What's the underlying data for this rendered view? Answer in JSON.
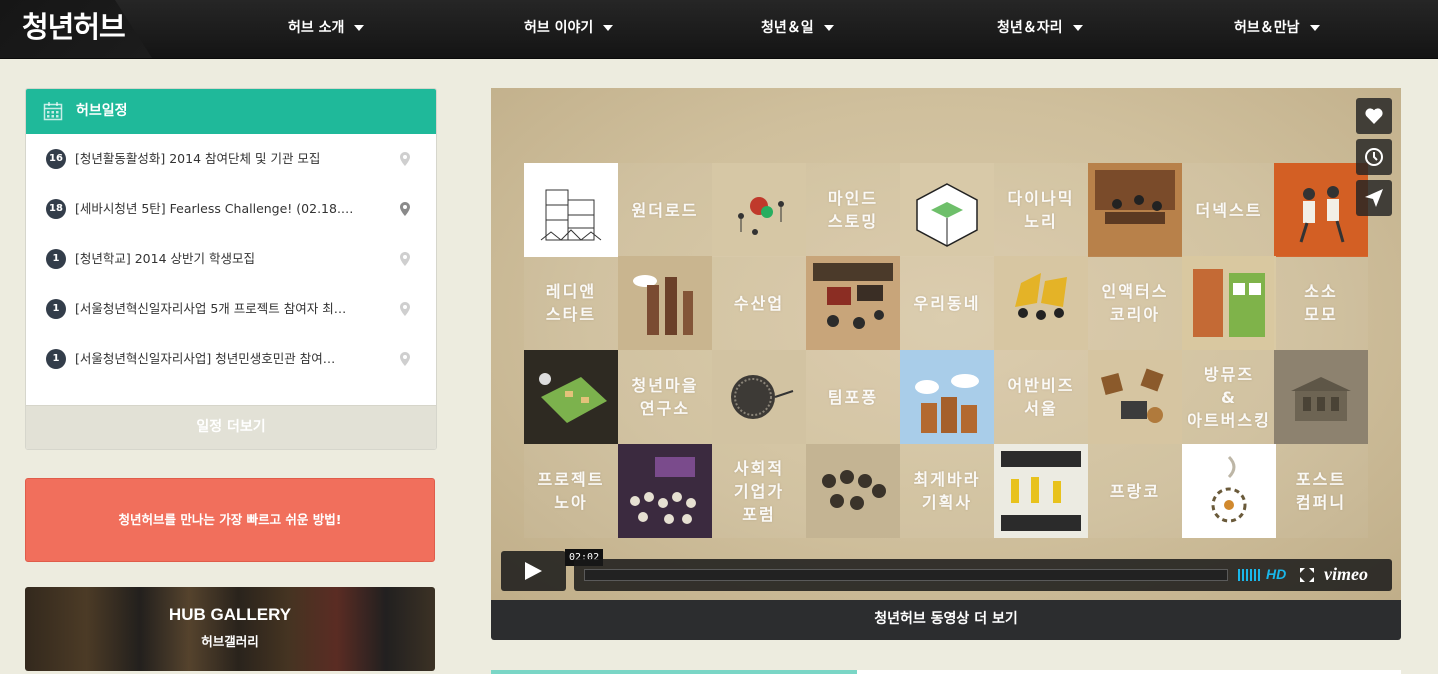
{
  "header": {
    "logo": "청년허브",
    "nav": [
      {
        "label": "허브 소개"
      },
      {
        "label": "허브 이야기"
      },
      {
        "label": "청년＆일"
      },
      {
        "label": "청년＆자리"
      },
      {
        "label": "허브＆만남"
      }
    ]
  },
  "schedule": {
    "title": "허브일정",
    "items": [
      {
        "day": "16",
        "title": "[청년활동활성화] 2014 참여단체 및 기관 모집"
      },
      {
        "day": "18",
        "title": "[세바시청년 5탄] Fearless Challenge! (02.18.…"
      },
      {
        "day": "1",
        "title": "[청년학교] 2014 상반기 학생모집"
      },
      {
        "day": "1",
        "title": "[서울청년혁신일자리사업 5개 프로젝트 참여자 최…"
      },
      {
        "day": "1",
        "title": "[서울청년혁신일자리사업] 청년민생호민관 참여…"
      }
    ],
    "more_label": "일정 더보기"
  },
  "promo": {
    "text": "청년허브를 만나는 가장 빠르고 쉬운 방법!"
  },
  "gallery": {
    "title": "HUB GALLERY",
    "subtitle": "허브갤러리"
  },
  "video": {
    "timecode": "02:02",
    "progress": 0,
    "hd_label": "HD",
    "brand": "vimeo",
    "tiles": [
      "원더로드",
      "마인드\n스토밍",
      "다이나믹\n노리",
      "더넥스트",
      "레디앤\n스타트",
      "수산업",
      "우리동네",
      "인액터스\n코리아",
      "소소\n모모",
      "청년마을\n연구소",
      "팀포퐁",
      "어반비즈\n서울",
      "방뮤즈\n&\n아트버스킹",
      "프로젝트\n노아",
      "사회적\n기업가\n포럼",
      "최게바라\n기획사",
      "프랑코",
      "포스트\n컴퍼니"
    ],
    "more_label": "청년허브 동영상 더 보기"
  },
  "colors": {
    "accent_green": "#1fb99a",
    "promo_red": "#f16f5c",
    "vimeo_blue": "#1ab7ea",
    "nav_bg": "#1c1c1c"
  },
  "icons": [
    "calendar-icon",
    "map-pin-icon",
    "heart-icon",
    "clock-icon",
    "send-icon",
    "play-icon",
    "volume-icon",
    "fullscreen-icon",
    "caret-down-icon"
  ]
}
